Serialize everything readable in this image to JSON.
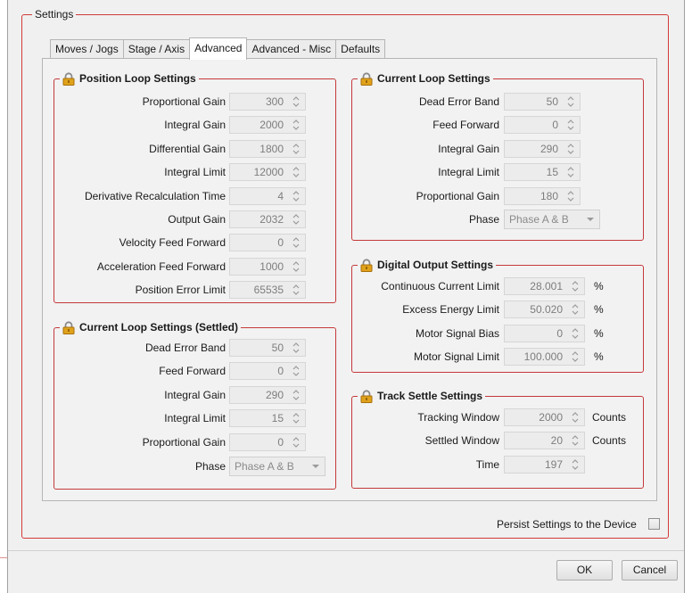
{
  "settings": {
    "title": "Settings",
    "tabs": [
      "Moves / Jogs",
      "Stage / Axis",
      "Advanced",
      "Advanced - Misc",
      "Defaults"
    ],
    "active_tab": "Advanced"
  },
  "position_loop": {
    "title": "Position Loop Settings",
    "fields": [
      {
        "label": "Proportional Gain",
        "value": "300"
      },
      {
        "label": "Integral Gain",
        "value": "2000"
      },
      {
        "label": "Differential Gain",
        "value": "1800"
      },
      {
        "label": "Integral Limit",
        "value": "12000"
      },
      {
        "label": "Derivative Recalculation Time",
        "value": "4"
      },
      {
        "label": "Output Gain",
        "value": "2032"
      },
      {
        "label": "Velocity Feed Forward",
        "value": "0"
      },
      {
        "label": "Acceleration Feed Forward",
        "value": "1000"
      },
      {
        "label": "Position Error Limit",
        "value": "65535"
      }
    ]
  },
  "current_loop_settled": {
    "title": "Current Loop Settings (Settled)",
    "fields": [
      {
        "label": "Dead Error Band",
        "value": "50"
      },
      {
        "label": "Feed Forward",
        "value": "0"
      },
      {
        "label": "Integral Gain",
        "value": "290"
      },
      {
        "label": "Integral Limit",
        "value": "15"
      },
      {
        "label": "Proportional Gain",
        "value": "0"
      }
    ],
    "phase_label": "Phase",
    "phase_value": "Phase A & B"
  },
  "current_loop": {
    "title": "Current Loop Settings",
    "fields": [
      {
        "label": "Dead Error Band",
        "value": "50"
      },
      {
        "label": "Feed Forward",
        "value": "0"
      },
      {
        "label": "Integral Gain",
        "value": "290"
      },
      {
        "label": "Integral Limit",
        "value": "15"
      },
      {
        "label": "Proportional Gain",
        "value": "180"
      }
    ],
    "phase_label": "Phase",
    "phase_value": "Phase A & B"
  },
  "digital_output": {
    "title": "Digital Output Settings",
    "fields": [
      {
        "label": "Continuous Current Limit",
        "value": "28.001",
        "unit": "%"
      },
      {
        "label": "Excess Energy Limit",
        "value": "50.020",
        "unit": "%"
      },
      {
        "label": "Motor Signal Bias",
        "value": "0",
        "unit": "%"
      },
      {
        "label": "Motor Signal Limit",
        "value": "100.000",
        "unit": "%"
      }
    ]
  },
  "track_settle": {
    "title": "Track Settle Settings",
    "fields": [
      {
        "label": "Tracking Window",
        "value": "2000",
        "unit": "Counts"
      },
      {
        "label": "Settled Window",
        "value": "20",
        "unit": "Counts"
      },
      {
        "label": "Time",
        "value": "197",
        "unit": ""
      }
    ]
  },
  "footer": {
    "persist_label": "Persist Settings to the Device",
    "persist_checked": false,
    "ok_label": "OK",
    "cancel_label": "Cancel"
  },
  "colors": {
    "group_border": "#c5383a",
    "lock_body": "#e0a21a",
    "disabled_text": "#7d7d7d"
  }
}
